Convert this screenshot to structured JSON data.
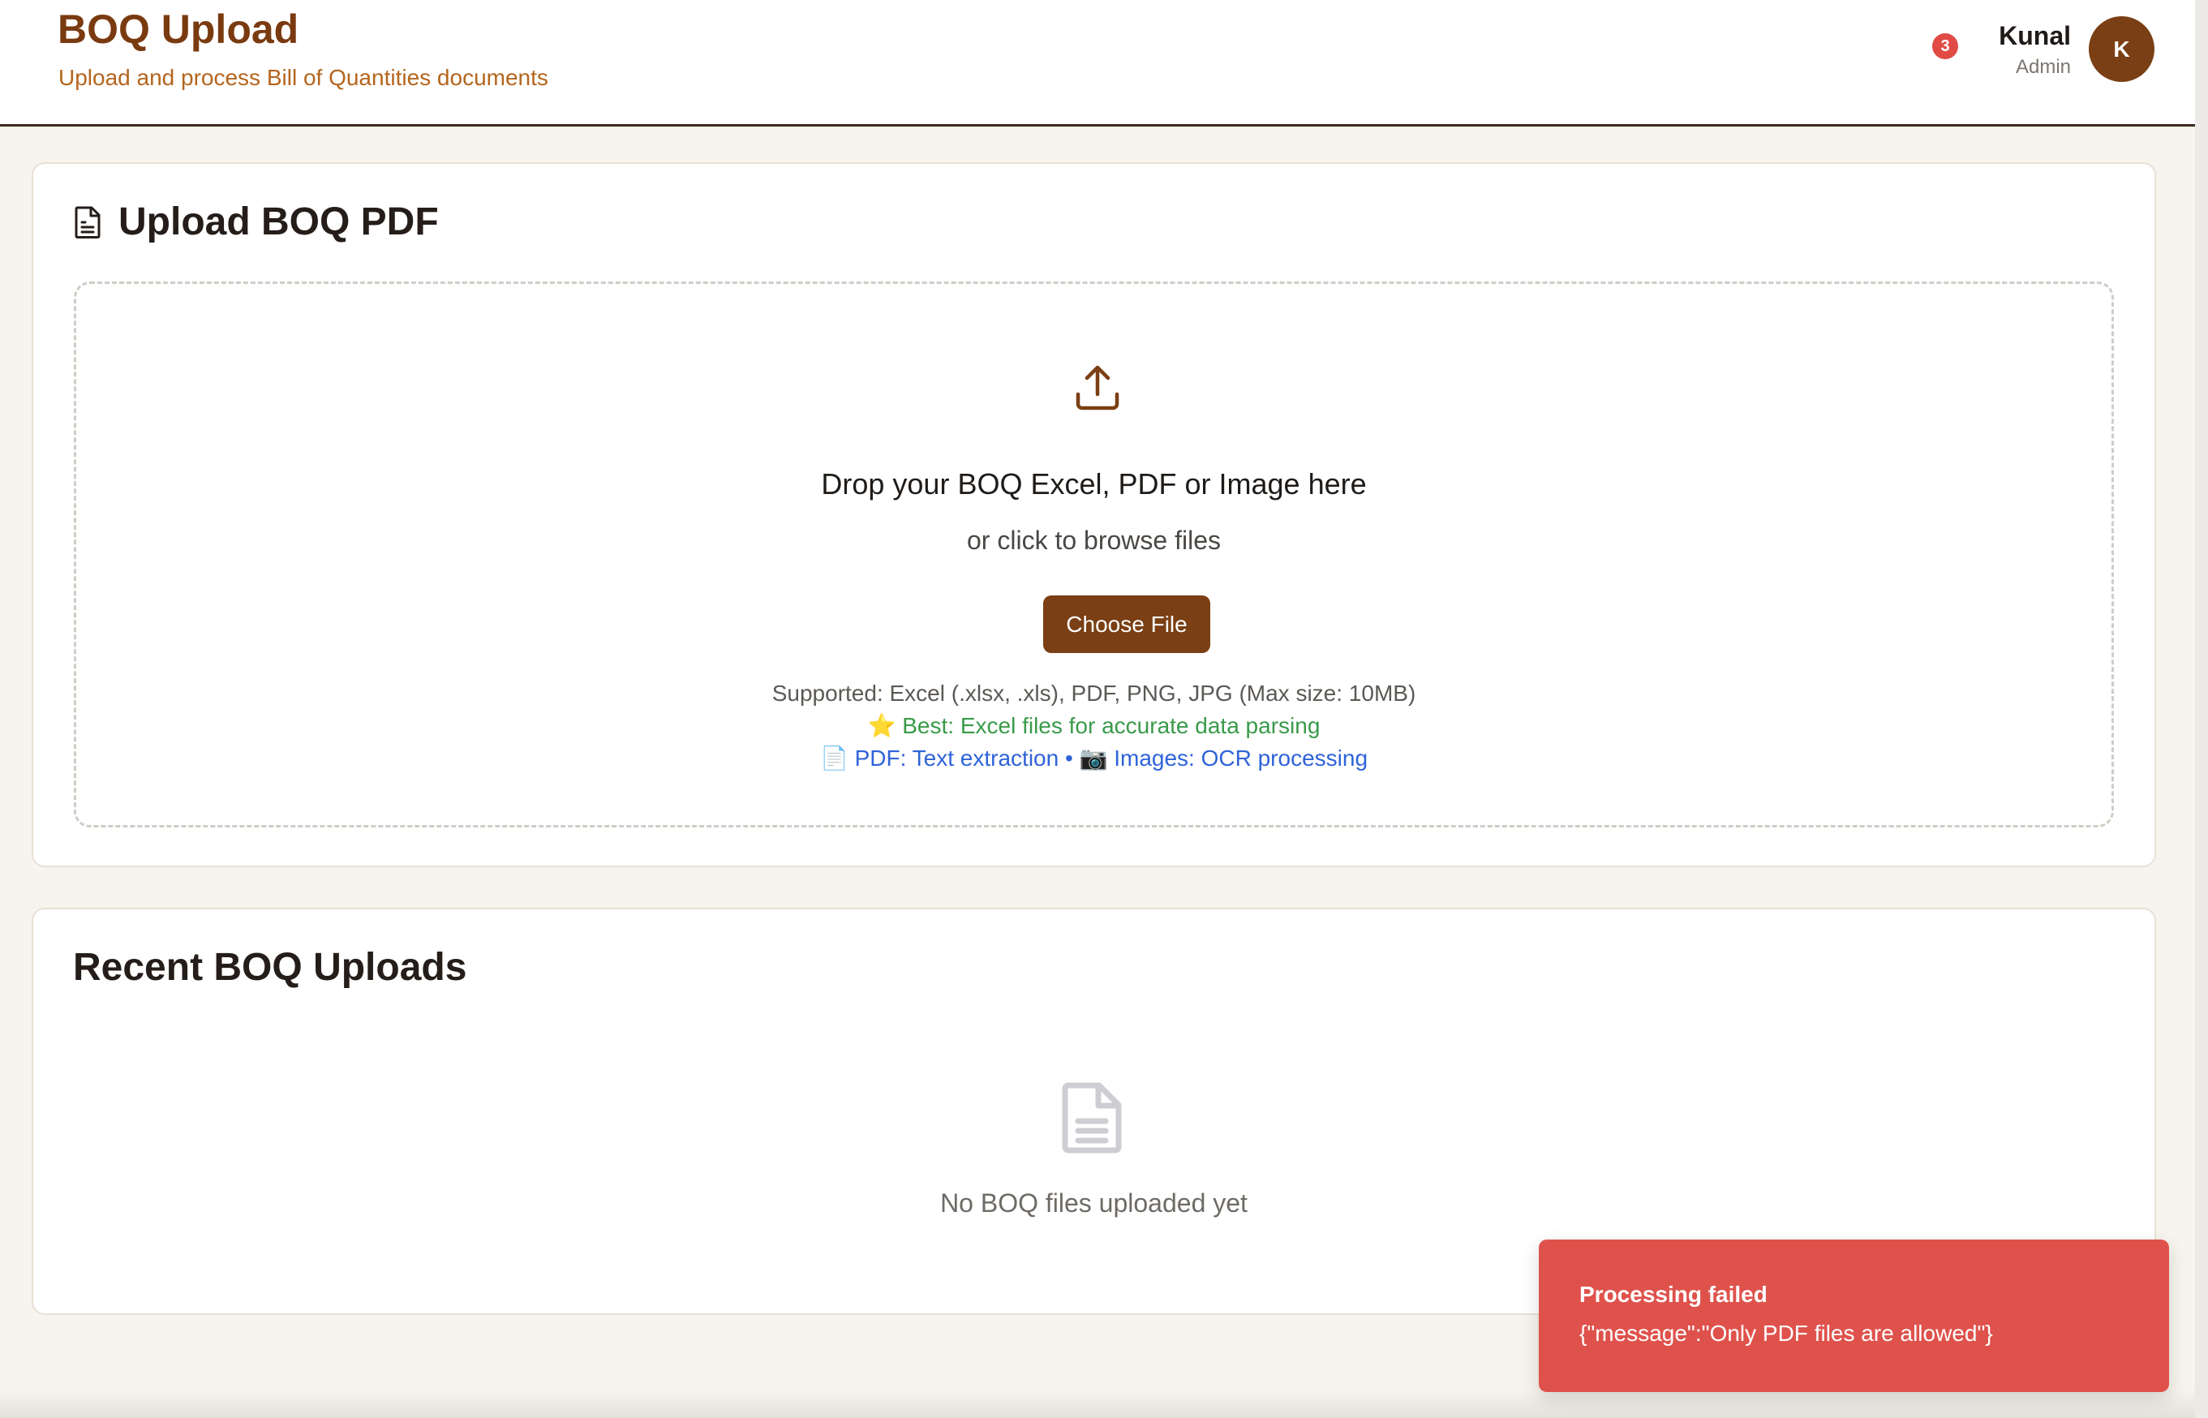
{
  "header": {
    "title": "BOQ Upload",
    "subtitle": "Upload and process Bill of Quantities documents",
    "notification_count": "3",
    "user_name": "Kunal",
    "user_role": "Admin",
    "avatar_initial": "K"
  },
  "upload_card": {
    "title": "Upload BOQ PDF",
    "title_icon": "document-icon",
    "dropzone": {
      "icon": "upload-icon",
      "title": "Drop your BOQ Excel, PDF or Image here",
      "subtitle": "or click to browse files",
      "button_label": "Choose File",
      "supported_text": "Supported: Excel (.xlsx, .xls), PDF, PNG, JPG (Max size: 10MB)",
      "best_emoji": "⭐",
      "best_text": "Best: Excel files for accurate data parsing",
      "pdf_emoji": "📄",
      "pdf_text": "PDF: Text extraction",
      "separator": "•",
      "image_emoji": "📷",
      "image_text": "Images: OCR processing"
    }
  },
  "recent_card": {
    "title": "Recent BOQ Uploads",
    "empty_icon": "file-text-icon",
    "empty_text": "No BOQ files uploaded yet"
  },
  "toast": {
    "title": "Processing failed",
    "message": "{\"message\":\"Only PDF files are allowed\"}"
  },
  "colors": {
    "brand_brown": "#7a3f14",
    "title_brown": "#7a3a10",
    "subtitle_orange": "#b5651d",
    "background": "#f7f4ee",
    "toast_red": "#df524c",
    "badge_red": "#e14b45",
    "success_green": "#3a9a4a",
    "info_blue": "#2f63d8"
  }
}
